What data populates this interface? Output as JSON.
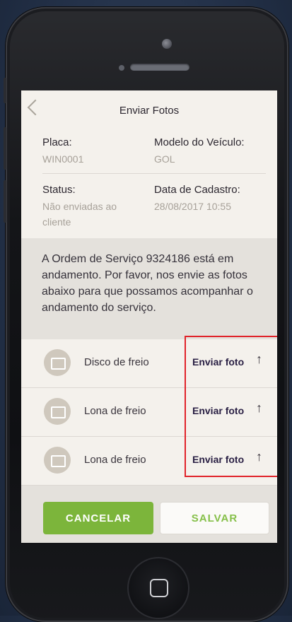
{
  "header": {
    "title": "Enviar Fotos",
    "back_icon": "chevron-left-icon"
  },
  "info": {
    "placa_label": "Placa:",
    "placa_value": "WIN0001",
    "modelo_label": "Modelo do Veículo:",
    "modelo_value": "GOL",
    "status_label": "Status:",
    "status_value_line1": "Não enviadas ao",
    "status_value_line2": "cliente",
    "data_label": "Data de Cadastro:",
    "data_value": "28/08/2017 10:55"
  },
  "message": "A Ordem de Serviço 9324186 está em andamento. Por favor, nos envie as fotos abaixo para que possamos acompanhar o andamento do serviço.",
  "photos": [
    {
      "label": "Disco de freio",
      "action": "Enviar foto",
      "icon": "image-icon",
      "action_icon": "upload-arrow-icon"
    },
    {
      "label": "Lona de freio",
      "action": "Enviar foto",
      "icon": "image-icon",
      "action_icon": "upload-arrow-icon"
    },
    {
      "label": "Lona de freio",
      "action": "Enviar foto",
      "icon": "image-icon",
      "action_icon": "upload-arrow-icon"
    }
  ],
  "footer": {
    "cancel_label": "CANCELAR",
    "save_label": "SALVAR"
  },
  "colors": {
    "accent_green": "#7cb53b",
    "highlight_red": "#e0232a"
  },
  "arrow_glyph": "↑"
}
